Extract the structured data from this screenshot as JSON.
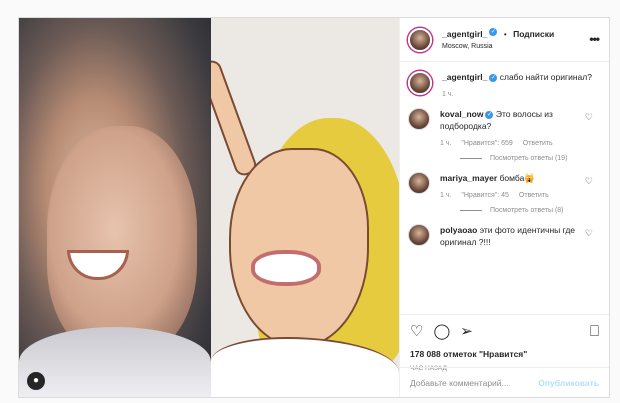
{
  "post": {
    "header": {
      "username": "_agentgirl_",
      "verified_icon": "verified-badge-icon",
      "separator": "•",
      "follow_label": "Подписки",
      "location": "Moscow, Russia",
      "more_icon": "more-options-icon"
    },
    "caption": {
      "username": "_agentgirl_",
      "text": "слабо найти оригинал?",
      "time": "1 ч."
    },
    "comments": [
      {
        "username": "koval_now",
        "text": "Это волосы из подбородка?",
        "time": "1 ч.",
        "likes": "\"Нравится\": 659",
        "reply_label": "Ответить",
        "view_replies": "Посмотреть ответы (19)"
      },
      {
        "username": "mariya_mayer",
        "text": "бомба🙀",
        "time": "1 ч.",
        "likes": "\"Нравится\": 45",
        "reply_label": "Ответить",
        "view_replies": "Посмотреть ответы (8)"
      },
      {
        "username": "polyaoao",
        "text": "эти фото идентичны где оригинал ?!!!"
      }
    ],
    "likes_text": "178 088 отметок \"Нравится\"",
    "timestamp": "ЧАС НАЗАД",
    "add_comment_placeholder": "Добавьте комментарий...",
    "post_button": "Опубликовать",
    "colors": {
      "accent": "#3897f0",
      "post_disabled": "#b2dffc",
      "hair": "#e6cb3f"
    }
  }
}
